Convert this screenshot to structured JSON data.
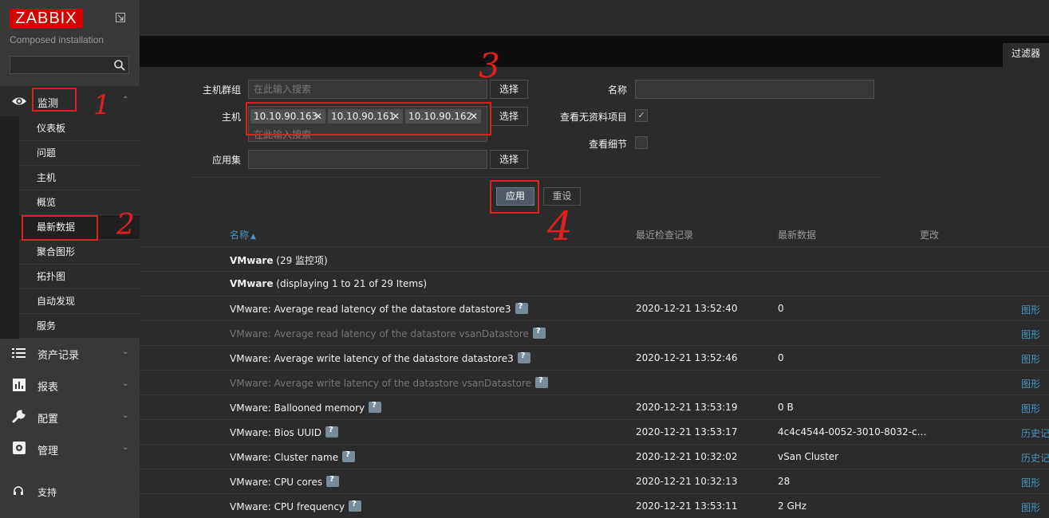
{
  "sidebar": {
    "logo": "ZABBIX",
    "subtitle": "Composed installation",
    "search_value": "",
    "monitoring": {
      "label": "监测",
      "items": [
        "仪表板",
        "问题",
        "主机",
        "概览",
        "最新数据",
        "聚合图形",
        "拓扑图",
        "自动发现",
        "服务"
      ],
      "active": "最新数据"
    },
    "inventory": "资产记录",
    "reports": "报表",
    "configuration": "配置",
    "administration": "管理",
    "support": "支持"
  },
  "tabs": {
    "filter": "过滤器"
  },
  "filter": {
    "host_groups_label": "主机群组",
    "host_groups_placeholder": "在此输入搜索",
    "hosts_label": "主机",
    "hosts": [
      "10.10.90.163",
      "10.10.90.161",
      "10.10.90.162"
    ],
    "hosts_placeholder": "在此输入搜索",
    "application_label": "应用集",
    "application_value": "",
    "select_label": "选择",
    "name_label": "名称",
    "name_value": "",
    "show_items_without_data_label": "查看无资料项目",
    "show_details_label": "查看细节",
    "apply": "应用",
    "reset": "重设"
  },
  "table": {
    "headers": {
      "name": "名称",
      "sort_indicator": "▲",
      "last_check": "最近检查记录",
      "last_value": "最新数据",
      "change": "更改"
    },
    "groups": [
      {
        "bold": "VMware",
        "text": " (29 监控项)"
      },
      {
        "bold": "VMware",
        "text": " (displaying 1 to 21 of 29 Items)"
      }
    ],
    "rows": [
      {
        "name": "VMware: Average read latency of the datastore datastore3",
        "last_check": "2020-12-21 13:52:40",
        "last_value": "0",
        "action": "图形",
        "dim": false
      },
      {
        "name": "VMware: Average read latency of the datastore vsanDatastore",
        "last_check": "",
        "last_value": "",
        "action": "图形",
        "dim": true
      },
      {
        "name": "VMware: Average write latency of the datastore datastore3",
        "last_check": "2020-12-21 13:52:46",
        "last_value": "0",
        "action": "图形",
        "dim": false
      },
      {
        "name": "VMware: Average write latency of the datastore vsanDatastore",
        "last_check": "",
        "last_value": "",
        "action": "图形",
        "dim": true
      },
      {
        "name": "VMware: Ballooned memory",
        "last_check": "2020-12-21 13:53:19",
        "last_value": "0 B",
        "action": "图形",
        "dim": false
      },
      {
        "name": "VMware: Bios UUID",
        "last_check": "2020-12-21 13:53:17",
        "last_value": "4c4c4544-0052-3010-8032-c…",
        "action": "历史记",
        "dim": false
      },
      {
        "name": "VMware: Cluster name",
        "last_check": "2020-12-21 10:32:02",
        "last_value": "vSan Cluster",
        "action": "历史记",
        "dim": false
      },
      {
        "name": "VMware: CPU cores",
        "last_check": "2020-12-21 10:32:13",
        "last_value": "28",
        "action": "图形",
        "dim": false
      },
      {
        "name": "VMware: CPU frequency",
        "last_check": "2020-12-21 13:53:11",
        "last_value": "2 GHz",
        "action": "图形",
        "dim": false
      }
    ]
  },
  "annotations": [
    "1",
    "2",
    "3",
    "4"
  ],
  "colors": {
    "annotation": "#e02020",
    "brand": "#d40000",
    "link": "#4796c4",
    "apply": "#4f5a66"
  }
}
